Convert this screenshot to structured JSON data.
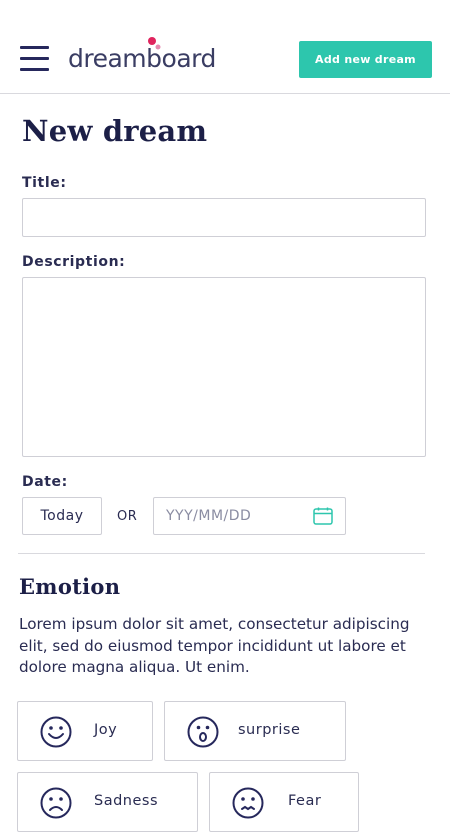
{
  "header": {
    "logo_text": "dreamboard",
    "add_button_label": "Add new dream",
    "accent_color": "#2dc6ad",
    "logo_dot_colors": [
      "#e0245e",
      "#e68ab0"
    ]
  },
  "form": {
    "title": "New dream",
    "title_label": "Title:",
    "title_value": "",
    "description_label": "Description:",
    "description_value": "",
    "date_label": "Date:",
    "today_button": "Today",
    "or_text": "OR",
    "date_placeholder": "YYY/MM/DD"
  },
  "emotion_section": {
    "title": "Emotion",
    "description": "Lorem ipsum dolor sit amet, consectetur adipiscing elit, sed do eiusmod tempor incididunt ut labore et dolore magna aliqua. Ut enim.",
    "options": [
      {
        "label": "Joy",
        "icon": "smile-face-icon"
      },
      {
        "label": "surprise",
        "icon": "surprised-face-icon"
      },
      {
        "label": "Sadness",
        "icon": "sad-face-icon"
      },
      {
        "label": "Fear",
        "icon": "fear-face-icon"
      }
    ]
  }
}
